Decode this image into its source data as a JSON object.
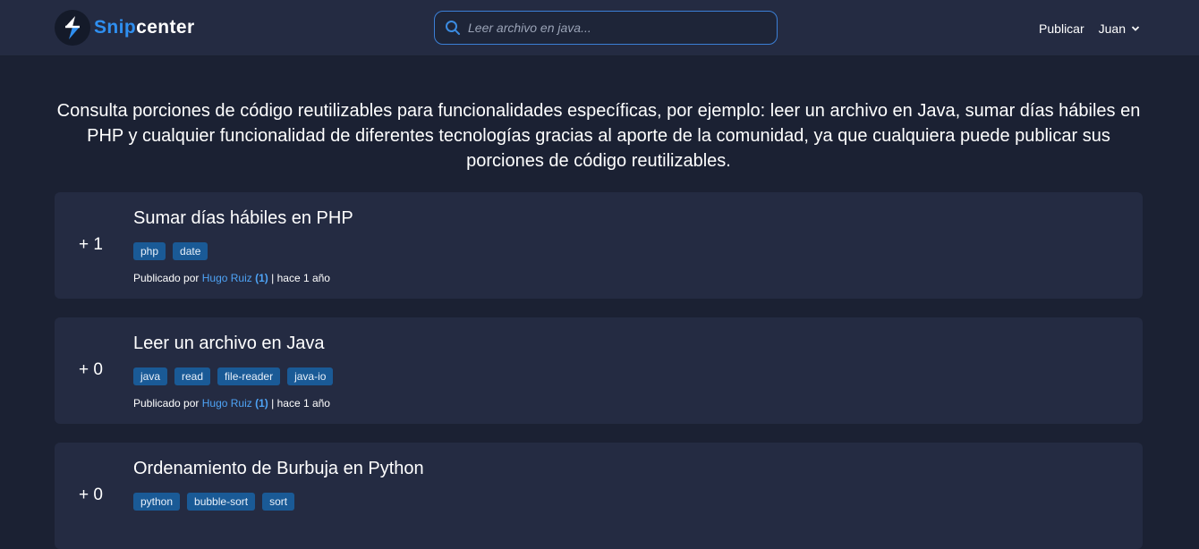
{
  "brand": {
    "part1": "Snip",
    "part2": "center",
    "accent": "#2f8ff0"
  },
  "search": {
    "placeholder": "Leer archivo en java..."
  },
  "nav": {
    "publish": "Publicar",
    "user": "Juan"
  },
  "intro": "Consulta porciones de código reutilizables para funcionalidades específicas, por ejemplo: leer un archivo en Java, sumar días hábiles en PHP y cualquier funcionalidad de diferentes tecnologías gracias al aporte de la comunidad, ya que cualquiera puede publicar sus porciones de código reutilizables.",
  "snippets": [
    {
      "votes": "+ 1",
      "title": "Sumar días hábiles en PHP",
      "tags": [
        "php",
        "date"
      ],
      "published_by": "Publicado por",
      "author": "Hugo Ruiz",
      "reputation": "(1)",
      "separator": "|",
      "time": "hace 1 año"
    },
    {
      "votes": "+ 0",
      "title": "Leer un archivo en Java",
      "tags": [
        "java",
        "read",
        "file-reader",
        "java-io"
      ],
      "published_by": "Publicado por",
      "author": "Hugo Ruiz",
      "reputation": "(1)",
      "separator": "|",
      "time": "hace 1 año"
    },
    {
      "votes": "+ 0",
      "title": "Ordenamiento de Burbuja en Python",
      "tags": [
        "python",
        "bubble-sort",
        "sort"
      ]
    }
  ]
}
